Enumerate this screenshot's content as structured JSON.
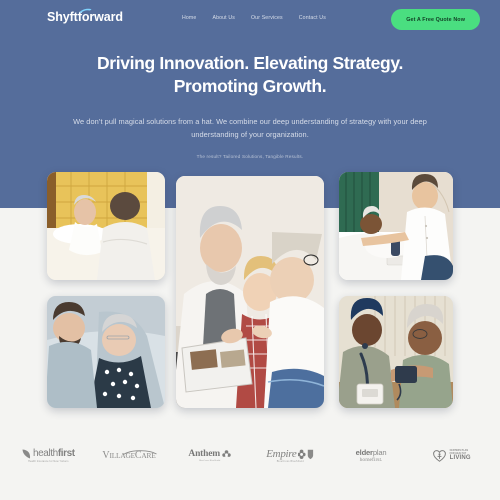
{
  "site": {
    "brand": "Shyftforward",
    "brand_swoosh_icon": "swoosh-accent-icon"
  },
  "nav": {
    "items": [
      {
        "label": "Home"
      },
      {
        "label": "About Us"
      },
      {
        "label": "Our Services"
      },
      {
        "label": "Contact Us"
      }
    ],
    "cta": {
      "label": "Get A Free Quote Now",
      "bg_color": "#4ade80",
      "text_color": "#123d24"
    }
  },
  "hero": {
    "bg_color": "#556d9b",
    "headline_line1": "Driving Innovation. Elevating Strategy.",
    "headline_line2": "Promoting Growth.",
    "subhead": "We don’t pull magical solutions from a hat. We combine our deep understanding of strategy with your deep understanding of your organization.",
    "tagline": "The result? Tailored Solutions, Tangible Results."
  },
  "gallery": {
    "items": [
      {
        "id": "card-top-left",
        "alt": "Caregiver comforting an elderly woman resting in a bed with a yellow tufted headboard",
        "palette": [
          "#e8c35a",
          "#f3ead8",
          "#cfa63f",
          "#f7f3ea"
        ]
      },
      {
        "id": "card-bottom-left",
        "alt": "Male caregiver leaning over an elderly woman with oxygen cannula lying in a hospital bed",
        "palette": [
          "#aab7c0",
          "#dfe5e8",
          "#3d4b57",
          "#f1f3f4"
        ]
      },
      {
        "id": "card-center",
        "alt": "Senior couple and a young girl looking at a photo album together on a sofa",
        "palette": [
          "#e9e4dd",
          "#7b7f86",
          "#3f5f8e",
          "#c6b8a8"
        ]
      },
      {
        "id": "card-top-right",
        "alt": "Young male nurse assisting an elderly man lying in bed near a green curtain",
        "palette": [
          "#2f6b52",
          "#efe9e0",
          "#d6c9b6",
          "#ffffff"
        ]
      },
      {
        "id": "card-bottom-right",
        "alt": "Nurse measuring the blood pressure of an elderly woman seated at a table",
        "palette": [
          "#1f3a5f",
          "#e2dcd0",
          "#8b8f7a",
          "#f0ece2"
        ]
      }
    ]
  },
  "partners": {
    "items": [
      {
        "id": "healthfirst",
        "name": "healthfirst",
        "name_light": "health",
        "name_bold": "first",
        "tagline": "Health Insurance for New Yorkers",
        "icon": "leaf-icon"
      },
      {
        "id": "villagecare",
        "name": "VillageCare",
        "part1_cap": "V",
        "part1_rest": "ILLAGE",
        "part2_cap": "C",
        "part2_rest": "ARE",
        "icon": "arc-swoosh-icon"
      },
      {
        "id": "anthem",
        "name": "Anthem",
        "tagline": "BlueCross BlueShield",
        "icon": "anthem-flower-icon"
      },
      {
        "id": "empire",
        "name": "Empire",
        "tagline": "BlueCross BlueShield",
        "icon": "cross-and-shield-icon"
      },
      {
        "id": "elderplan",
        "name": "elderplan",
        "name_bold": "elder",
        "name_light": "plan",
        "tagline": "homefirst.",
        "icon": "none"
      },
      {
        "id": "centers-plan-healthy-living",
        "name": "CENTERS PLAN FOR HEALTHY LIVING",
        "line1": "CENTERS PLAN",
        "line2": "FOR HEALTHY",
        "line3": "LIVING",
        "icon": "heart-person-icon"
      }
    ]
  }
}
